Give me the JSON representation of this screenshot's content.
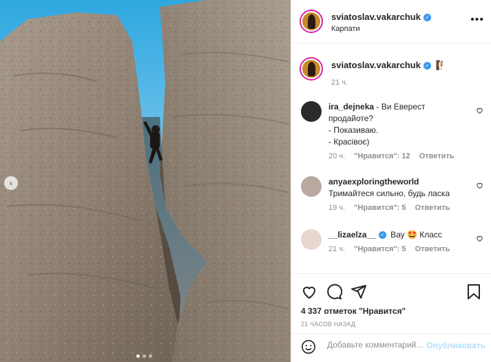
{
  "post": {
    "author": "sviatoslav.vakarchuk",
    "location": "Карпати",
    "caption_emoji": "🧗",
    "caption_time": "21 ч."
  },
  "comments": [
    {
      "user": "ira_dejneka",
      "lines": [
        "- Ви Еверест",
        "продайоте?",
        "- Показиваю.",
        "- Красівоє)"
      ],
      "time": "20 ч.",
      "likes": "\"Нравится\": 12",
      "reply": "Ответить"
    },
    {
      "user": "anyaexploringtheworld",
      "lines": [
        "Тримайтеся сильно, будь ласка"
      ],
      "time": "19 ч.",
      "likes": "\"Нравится\": 5",
      "reply": "Ответить"
    },
    {
      "user": "__lizaelza__",
      "lines": [
        "Вау 🤩 Класс"
      ],
      "time": "21 ч.",
      "likes": "\"Нравится\": 5",
      "reply": "Ответить",
      "verified": true
    }
  ],
  "actions": {
    "likes_text": "4 337 отметок \"Нравится\"",
    "posted_text": "21 ЧАСОВ НАЗАД",
    "comment_placeholder": "Добавьте комментарий...",
    "publish_label": "Опубликовать"
  },
  "icons": {
    "like": "heart-icon",
    "comment": "comment-icon",
    "share": "share-icon",
    "save": "bookmark-icon",
    "emoji": "smiley-icon",
    "more": "more-icon",
    "verified": "verified-badge-icon"
  },
  "colors": {
    "verified": "#3897f0",
    "publish_disabled": "#b2dffc",
    "story_ring": "#d6249f",
    "sky": "#5bb6dd"
  },
  "carousel": {
    "slide_count": 3,
    "active_slide": 1
  }
}
